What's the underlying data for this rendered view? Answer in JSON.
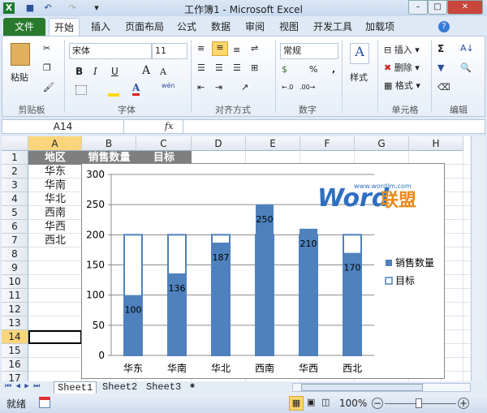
{
  "window": {
    "title": "工作簿1 - Microsoft Excel"
  },
  "tabs": {
    "file": "文件",
    "items": [
      "开始",
      "插入",
      "页面布局",
      "公式",
      "数据",
      "审阅",
      "视图",
      "开发工具",
      "加载项"
    ]
  },
  "ribbon": {
    "clipboard": {
      "label": "剪贴板",
      "paste": "粘贴"
    },
    "font": {
      "label": "字体",
      "name": "宋体",
      "size": "11",
      "bold": "B",
      "italic": "I",
      "underline": "U",
      "grow": "A",
      "shrink": "A",
      "color": "A",
      "phonetic": "wén"
    },
    "alignment": {
      "label": "对齐方式"
    },
    "number": {
      "label": "数字",
      "format": "常规",
      "percent": "%",
      "comma": ","
    },
    "styles": {
      "label": "样式"
    },
    "cells": {
      "label": "单元格",
      "insert": "插入",
      "delete": "删除",
      "format": "格式"
    },
    "editing": {
      "label": "编辑",
      "sum": "Σ"
    }
  },
  "formula_bar": {
    "name_box": "A14",
    "fx": "fx",
    "value": ""
  },
  "grid": {
    "columns": [
      "A",
      "B",
      "C",
      "D",
      "E",
      "F",
      "G",
      "H"
    ],
    "rows": [
      "1",
      "2",
      "3",
      "4",
      "5",
      "6",
      "7",
      "8",
      "9",
      "10",
      "11",
      "12",
      "13",
      "14",
      "15",
      "16",
      "17"
    ],
    "header": [
      "地区",
      "销售数量",
      "目标"
    ],
    "regions": [
      "华东",
      "华南",
      "华北",
      "西南",
      "华西",
      "西北"
    ]
  },
  "chart_data": {
    "type": "bar",
    "categories": [
      "华东",
      "华南",
      "华北",
      "西南",
      "华西",
      "西北"
    ],
    "series": [
      {
        "name": "销售数量",
        "values": [
          100,
          136,
          187,
          250,
          210,
          170
        ],
        "color": "#4f81bd"
      },
      {
        "name": "目标",
        "values": [
          200,
          200,
          200,
          200,
          200,
          200
        ],
        "color": "#ffffff"
      }
    ],
    "yticks": [
      "0",
      "50",
      "100",
      "150",
      "200",
      "250",
      "300"
    ],
    "ylim": [
      0,
      300
    ],
    "legend": "right",
    "grid": true,
    "watermark": "Word联盟 www.wordlm.com"
  },
  "sheets": [
    "Sheet1",
    "Sheet2",
    "Sheet3"
  ],
  "status": {
    "ready": "就绪",
    "zoom": "100%"
  }
}
